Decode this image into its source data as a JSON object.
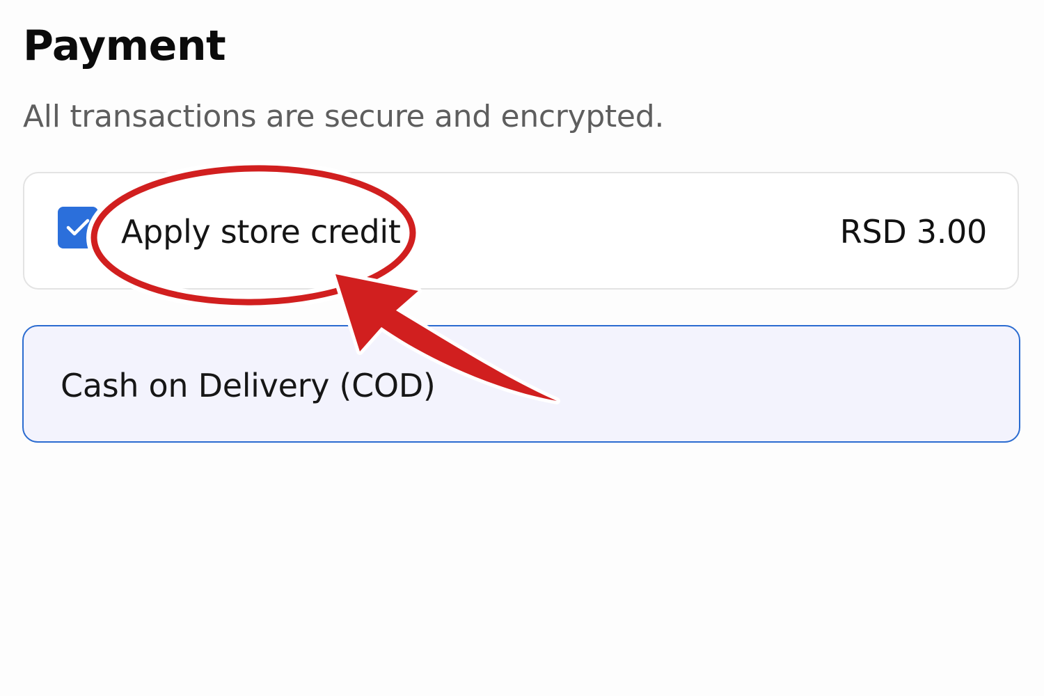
{
  "payment": {
    "title": "Payment",
    "subtitle": "All transactions are secure and encrypted."
  },
  "store_credit": {
    "label": "Apply store credit",
    "amount": "RSD 3.00",
    "checked": true
  },
  "cod": {
    "label": "Cash on Delivery (COD)"
  },
  "colors": {
    "accent": "#2b6fdb",
    "annotation": "#d11f1f",
    "cod_background": "#f3f3fd"
  },
  "icons": {
    "checkbox": "check-icon",
    "annotation_arrow": "curved-arrow-icon",
    "annotation_circle": "highlight-ellipse"
  }
}
